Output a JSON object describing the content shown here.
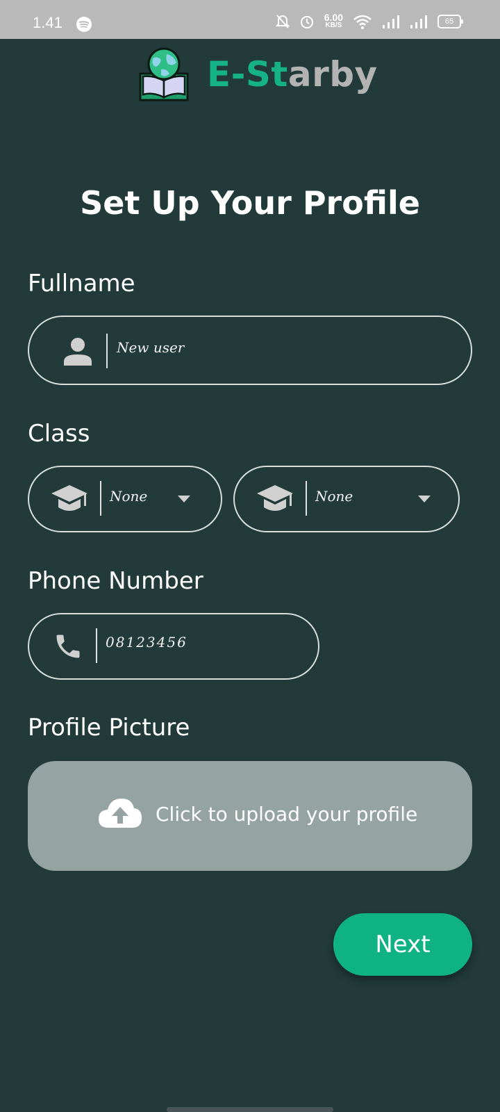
{
  "status_bar": {
    "time": "1.41",
    "net_speed_value": "6.00",
    "net_speed_unit": "KB/S",
    "battery": "65"
  },
  "brand": {
    "name_accent": "E-St",
    "name_rest": "arby",
    "accent_color": "#16b287"
  },
  "page_title": "Set Up Your Profile",
  "fullname": {
    "label": "Fullname",
    "value": "New user",
    "icon": "person-icon"
  },
  "class": {
    "label": "Class",
    "select_1": {
      "value": "None",
      "icon": "graduation-cap-icon"
    },
    "select_2": {
      "value": "None",
      "icon": "graduation-cap-icon"
    }
  },
  "phone": {
    "label": "Phone Number",
    "value": "08123456",
    "icon": "phone-icon"
  },
  "profile_picture": {
    "label": "Profile Picture",
    "upload_text": "Click to upload your profile",
    "icon": "cloud-upload-icon"
  },
  "next_button": {
    "label": "Next",
    "color": "#0fb383"
  }
}
